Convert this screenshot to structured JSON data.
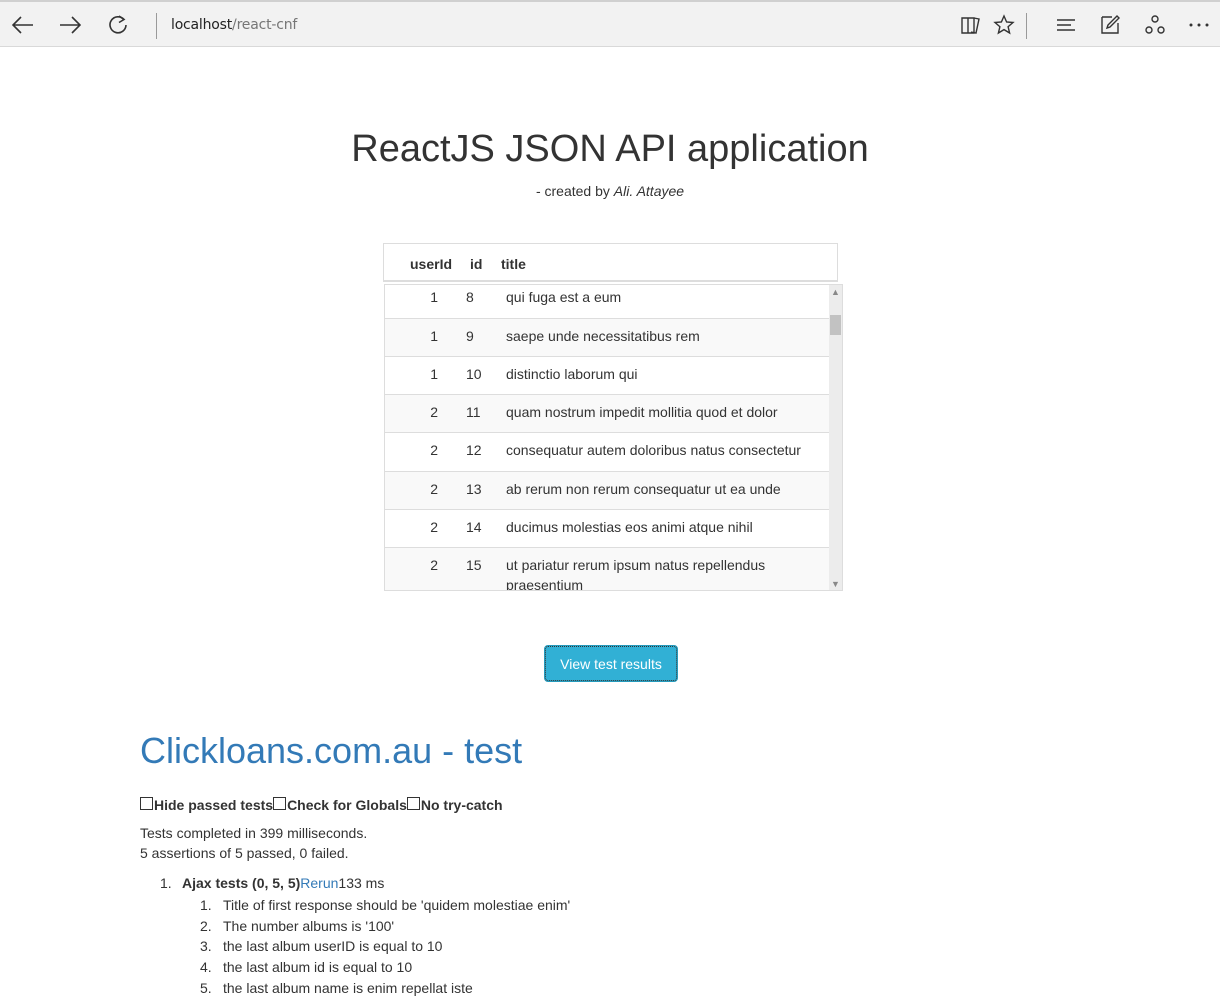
{
  "browser": {
    "url_host": "localhost",
    "url_path": "/react-cnf"
  },
  "header": {
    "title": "ReactJS JSON API application",
    "byline_prefix": "- created by ",
    "author": "Ali. Attayee"
  },
  "table": {
    "columns": [
      "userId",
      "id",
      "title"
    ],
    "rows": [
      {
        "userId": "1",
        "id": "8",
        "title": "qui fuga est a eum"
      },
      {
        "userId": "1",
        "id": "9",
        "title": "saepe unde necessitatibus rem"
      },
      {
        "userId": "1",
        "id": "10",
        "title": "distinctio laborum qui"
      },
      {
        "userId": "2",
        "id": "11",
        "title": "quam nostrum impedit mollitia quod et dolor"
      },
      {
        "userId": "2",
        "id": "12",
        "title": "consequatur autem doloribus natus consectetur"
      },
      {
        "userId": "2",
        "id": "13",
        "title": "ab rerum non rerum consequatur ut ea unde"
      },
      {
        "userId": "2",
        "id": "14",
        "title": "ducimus molestias eos animi atque nihil"
      },
      {
        "userId": "2",
        "id": "15",
        "title": "ut pariatur rerum ipsum natus repellendus praesentium"
      }
    ]
  },
  "actions": {
    "view_results_label": "View test results"
  },
  "qunit": {
    "header": "Clickloans.com.au - test",
    "options": {
      "hide_passed": "Hide passed tests",
      "check_globals": "Check for Globals",
      "no_try_catch": "No try-catch"
    },
    "completed_text": "Tests completed in 399 milliseconds.",
    "summary_text": "5 assertions of 5 passed, 0 failed.",
    "module": {
      "number": "1.",
      "name": "Ajax tests (0, 5, 5)",
      "rerun_label": "Rerun",
      "duration": "133 ms"
    },
    "assertions": [
      {
        "number": "1.",
        "text": "Title of first response should be 'quidem molestiae enim'"
      },
      {
        "number": "2.",
        "text": "The number albums is '100'"
      },
      {
        "number": "3.",
        "text": "the last album userID is equal to 10"
      },
      {
        "number": "4.",
        "text": "the last album id is equal to 10"
      },
      {
        "number": "5.",
        "text": "the last album name is enim repellat iste"
      }
    ]
  }
}
